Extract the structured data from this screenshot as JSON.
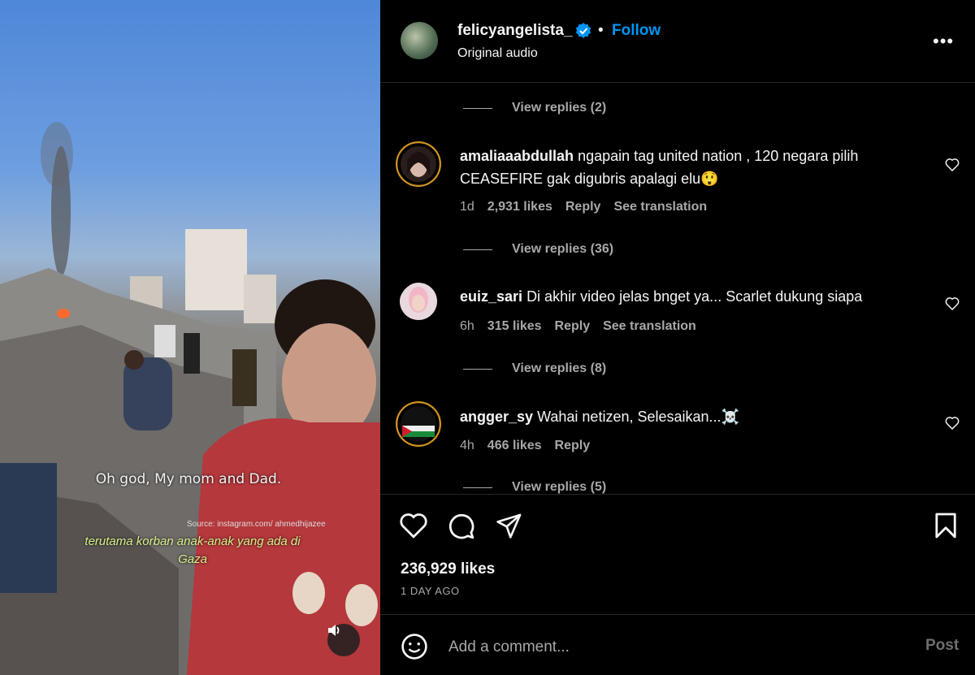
{
  "media": {
    "caption_main": "Oh god, My mom and Dad.",
    "caption_source": "Source: instagram.com/ ahmedhijazee",
    "caption_sub": "terutama korban anak-anak yang ada di Gaza",
    "sound_icon": "speaker-icon"
  },
  "header": {
    "username": "felicyangelista_",
    "separator": "•",
    "follow_label": "Follow",
    "audio_label": "Original audio",
    "more_icon": "•••"
  },
  "comments": [
    {
      "view_replies": "View replies (2)"
    },
    {
      "username": "amaliaaabdullah",
      "text": "ngapain tag united nation , 120 negara pilih CEASEFIRE gak digubris apalagi elu😲",
      "time": "1d",
      "likes": "2,931 likes",
      "reply": "Reply",
      "translate": "See translation",
      "view_replies": "View replies (36)"
    },
    {
      "username": "euiz_sari",
      "text": "Di akhir video jelas bnget ya... Scarlet dukung siapa",
      "time": "6h",
      "likes": "315 likes",
      "reply": "Reply",
      "translate": "See translation",
      "view_replies": "View replies (8)"
    },
    {
      "username": "angger_sy",
      "text": "Wahai netizen, Selesaikan...☠️",
      "time": "4h",
      "likes": "466 likes",
      "reply": "Reply",
      "view_replies": "View replies (5)"
    }
  ],
  "footer": {
    "likes": "236,929 likes",
    "date": "1 DAY AGO",
    "add_comment_placeholder": "Add a comment...",
    "post_label": "Post"
  },
  "colors": {
    "accent": "#0095f6",
    "muted": "#a8a8a8",
    "background": "#000000"
  }
}
